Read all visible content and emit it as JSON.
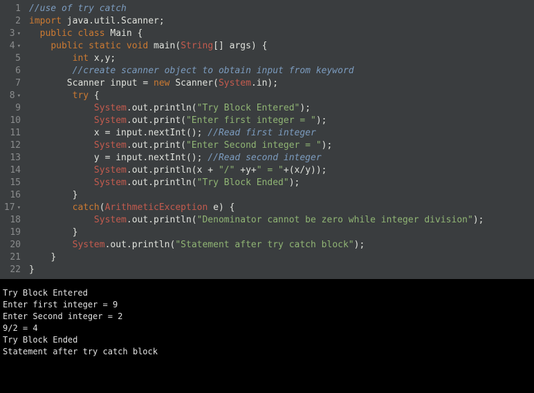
{
  "gutter": {
    "lines": [
      "1",
      "2",
      "3",
      "4",
      "5",
      "6",
      "7",
      "8",
      "9",
      "10",
      "11",
      "12",
      "13",
      "14",
      "15",
      "16",
      "17",
      "18",
      "19",
      "20",
      "21",
      "22"
    ],
    "foldable": [
      3,
      4,
      8,
      17
    ]
  },
  "code": {
    "l1": "//use of try catch",
    "l2_kw1": "import",
    "l2_rest": " java.util.Scanner;",
    "l3_kw1": "public",
    "l3_kw2": "class",
    "l3_name": "Main",
    "l3_brace": " {",
    "l4_kw1": "public",
    "l4_kw2": "static",
    "l4_kw3": "void",
    "l4_method": "main",
    "l4_type": "String",
    "l4_rest": "[] args) {",
    "l5_kw": "int",
    "l5_rest": " x,y;",
    "l6": "//create scanner object to obtain input from keyword",
    "l7_a": "Scanner input ",
    "l7_op": "=",
    "l7_kw": " new",
    "l7_b": " Scanner(",
    "l7_sys": "System",
    "l7_c": ".in);",
    "l8_kw": "try",
    "l8_brace": " {",
    "l9_sys": "System",
    "l9_a": ".out.println(",
    "l9_str": "\"Try Block Entered\"",
    "l9_b": ");",
    "l10_sys": "System",
    "l10_a": ".out.print(",
    "l10_str": "\"Enter first integer = \"",
    "l10_b": ");",
    "l11_a": "x ",
    "l11_op": "=",
    "l11_b": " input.nextInt(); ",
    "l11_c": "//Read first integer",
    "l12_sys": "System",
    "l12_a": ".out.print(",
    "l12_str": "\"Enter Second integer = \"",
    "l12_b": ");",
    "l13_a": "y ",
    "l13_op": "=",
    "l13_b": " input.nextInt(); ",
    "l13_c": "//Read second integer",
    "l14_sys": "System",
    "l14_a": ".out.println(x ",
    "l14_op1": "+",
    "l14_str1": " \"/\" ",
    "l14_op2": "+",
    "l14_b": "y",
    "l14_op3": "+",
    "l14_str2": "\" = \"",
    "l14_op4": "+",
    "l14_c": "(x/y));",
    "l15_sys": "System",
    "l15_a": ".out.println(",
    "l15_str": "\"Try Block Ended\"",
    "l15_b": ");",
    "l16": "}",
    "l17_kw": "catch",
    "l17_a": "(",
    "l17_type": "ArithmeticException",
    "l17_b": " e) {",
    "l18_sys": "System",
    "l18_a": ".out.println(",
    "l18_str": "\"Denominator cannot be zero while integer division\"",
    "l18_b": ");",
    "l19": "}",
    "l20_sys": "System",
    "l20_a": ".out.println(",
    "l20_str": "\"Statement after try catch block\"",
    "l20_b": ");",
    "l21": "}",
    "l22": "}"
  },
  "terminal": {
    "line1": "Try Block Entered",
    "line2": "Enter first integer = 9",
    "line3": "Enter Second integer = 2",
    "line4": "9/2 = 4",
    "line5": "Try Block Ended",
    "line6": "Statement after try catch block"
  }
}
